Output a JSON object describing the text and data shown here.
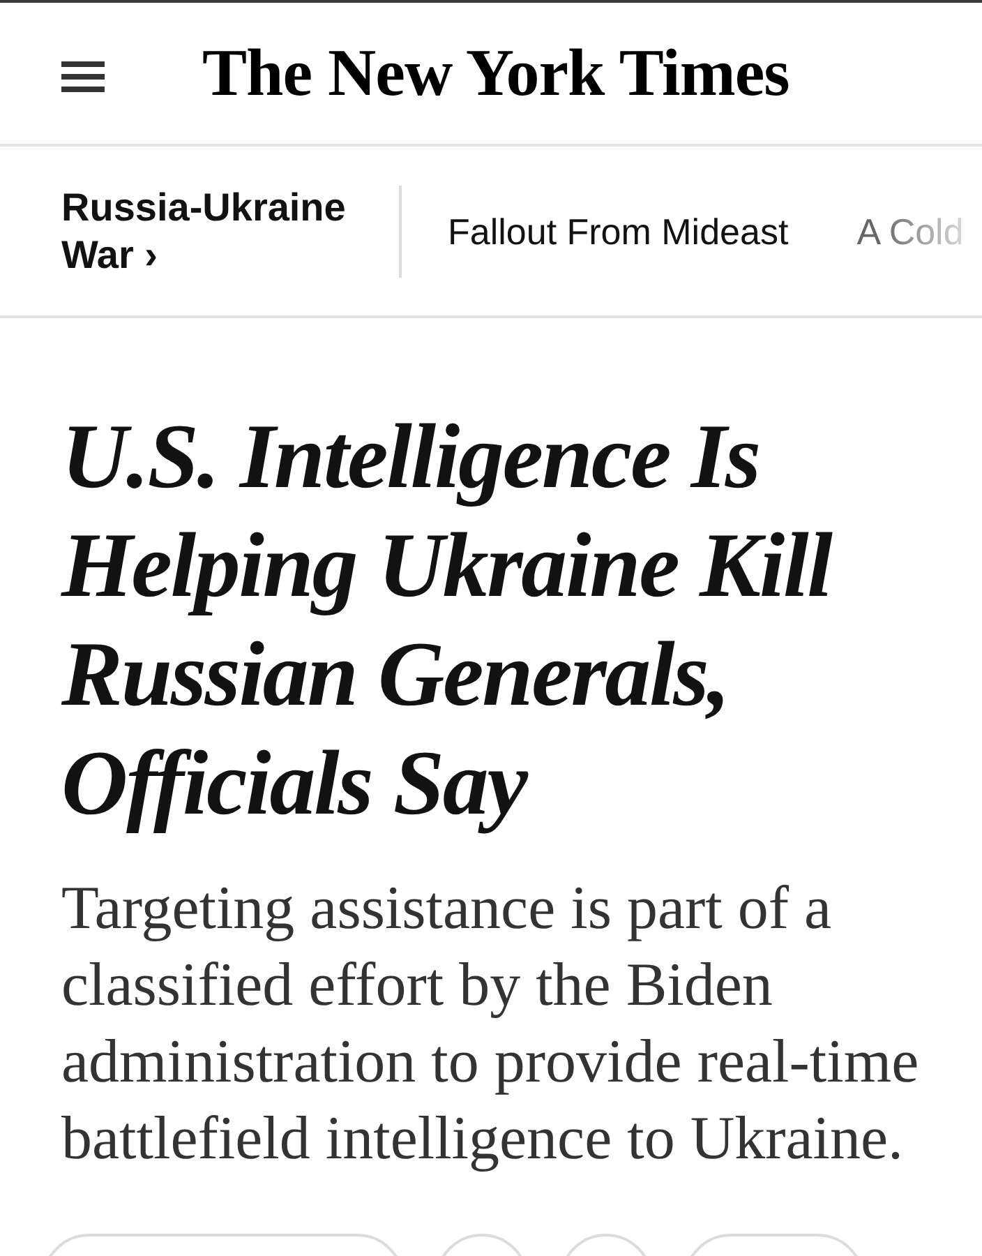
{
  "masthead": {
    "logo": "The New York Times"
  },
  "section_nav": {
    "section": {
      "label": "Russia-Ukraine War",
      "chevron": "›"
    },
    "links": [
      "Fallout From Mideast",
      "A Cold"
    ]
  },
  "article": {
    "headline": "U.S. Intelligence Is Helping Ukraine Kill Russian Generals, Officials Say",
    "summary": "Targeting assistance is part of a classified effort by the Biden administration to provide real-time battlefield intelligence to Ukraine."
  },
  "action_bar": {
    "buttons": [
      {
        "kind": "pill"
      },
      {
        "kind": "round"
      },
      {
        "kind": "round"
      },
      {
        "kind": "pill-short"
      }
    ]
  }
}
